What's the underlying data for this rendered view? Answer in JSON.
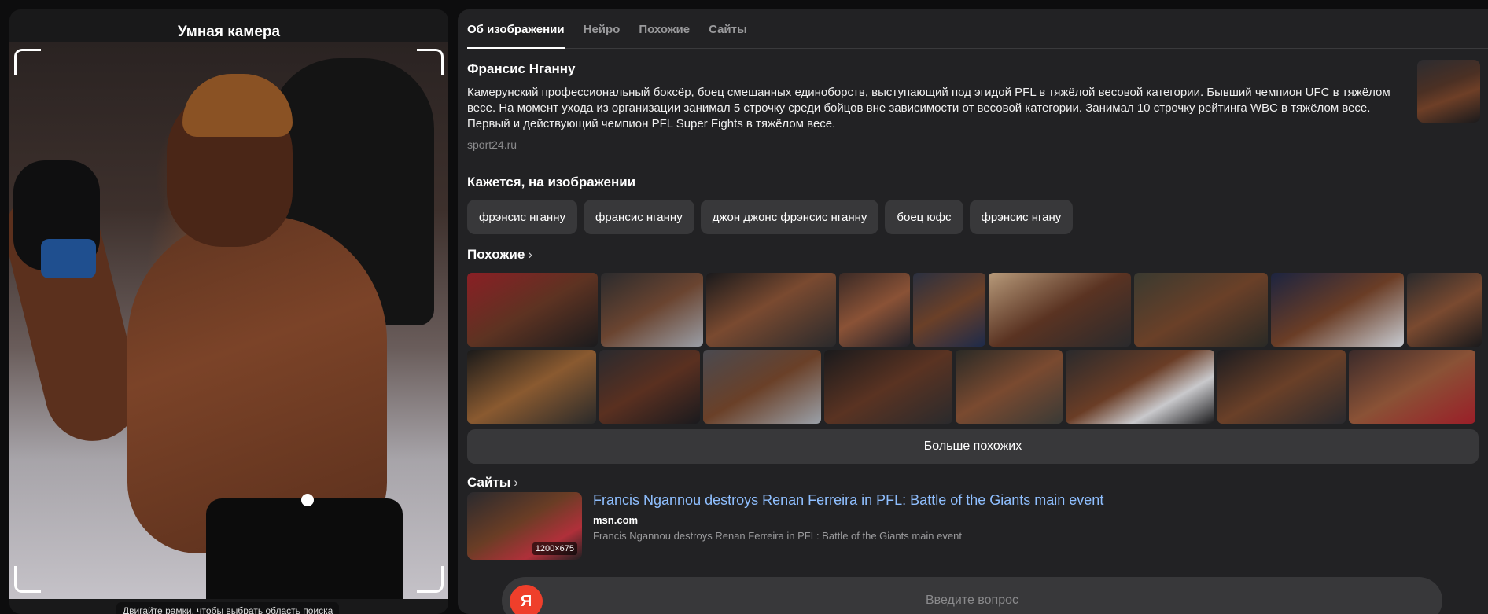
{
  "left_panel": {
    "title": "Умная камера",
    "hint": "Двигайте рамки, чтобы выбрать область поиска"
  },
  "tabs": [
    {
      "label": "Об изображении",
      "active": true
    },
    {
      "label": "Нейро",
      "active": false
    },
    {
      "label": "Похожие",
      "active": false
    },
    {
      "label": "Сайты",
      "active": false
    }
  ],
  "entity": {
    "name": "Франсис Нганну",
    "description": "Камерунский профессиональный боксёр, боец смешанных единоборств, выступающий под эгидой PFL в тяжёлой весовой категории. Бывший чемпион UFC в тяжёлом весе. На момент ухода из организации занимал 5 строчку среди бойцов вне зависимости от весовой категории. Занимал 10 строчку рейтинга WBC в тяжёлом весе. Первый и действующий чемпион PFL Super Fights в тяжёлом весе.",
    "source": "sport24.ru"
  },
  "seems_section": {
    "title": "Кажется, на изображении",
    "chips": [
      "фрэнсис нганну",
      "франсис нганну",
      "джон джонс фрэнсис нганну",
      "боец юфс",
      "фрэнсис нгану"
    ]
  },
  "similar_section": {
    "title": "Похожие",
    "more_label": "Больше похожих"
  },
  "sites_section": {
    "title": "Сайты",
    "result": {
      "title": "Francis Ngannou destroys Renan Ferreira in PFL: Battle of the Giants main event",
      "domain": "msn.com",
      "snippet": "Francis Ngannou destroys Renan Ferreira in PFL: Battle of the Giants main event",
      "thumb_size": "1200×675"
    }
  },
  "ask_bar": {
    "logo": "Я",
    "placeholder": "Введите вопрос"
  },
  "icons": {
    "chevron": "chevron-right-icon",
    "logo": "yandex-alice-icon"
  },
  "colors": {
    "accent_link": "#8fbfff",
    "logo_red": "#ef3f2b"
  }
}
